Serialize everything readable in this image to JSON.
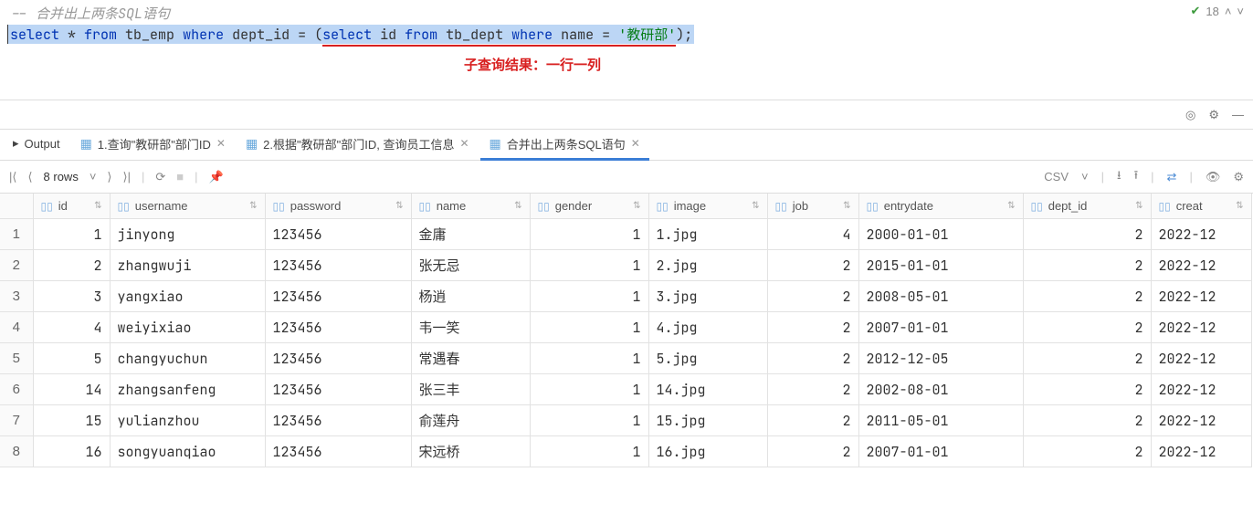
{
  "editor": {
    "comment": "-- 合并出上两条SQL语句",
    "sql_select": "select",
    "sql_star": " * ",
    "sql_from": "from",
    "tb_emp": " tb_emp ",
    "sql_where": "where",
    "dept_id_eq": " dept_id = (",
    "sql_select2": "select",
    "id_from": " id ",
    "sql_from2": "from",
    "tb_dept": " tb_dept ",
    "sql_where2": "where",
    "name_eq": " name = ",
    "lit": "'教研部'",
    "close": ");",
    "annotation": "子查询结果：一行一列"
  },
  "status": {
    "count": "18"
  },
  "tabs": {
    "output": "Output",
    "t1": "1.查询\"教研部\"部门ID",
    "t2": "2.根据\"教研部\"部门ID, 查询员工信息",
    "t3": "合并出上两条SQL语句"
  },
  "resultbar": {
    "rows": "8 rows",
    "csv": "CSV"
  },
  "columns": [
    "id",
    "username",
    "password",
    "name",
    "gender",
    "image",
    "job",
    "entrydate",
    "dept_id",
    "creat"
  ],
  "rows": [
    {
      "n": "1",
      "id": "1",
      "username": "jinyong",
      "password": "123456",
      "name": "金庸",
      "gender": "1",
      "image": "1.jpg",
      "job": "4",
      "entrydate": "2000-01-01",
      "dept_id": "2",
      "creat": "2022-12"
    },
    {
      "n": "2",
      "id": "2",
      "username": "zhangwuji",
      "password": "123456",
      "name": "张无忌",
      "gender": "1",
      "image": "2.jpg",
      "job": "2",
      "entrydate": "2015-01-01",
      "dept_id": "2",
      "creat": "2022-12"
    },
    {
      "n": "3",
      "id": "3",
      "username": "yangxiao",
      "password": "123456",
      "name": "杨逍",
      "gender": "1",
      "image": "3.jpg",
      "job": "2",
      "entrydate": "2008-05-01",
      "dept_id": "2",
      "creat": "2022-12"
    },
    {
      "n": "4",
      "id": "4",
      "username": "weiyixiao",
      "password": "123456",
      "name": "韦一笑",
      "gender": "1",
      "image": "4.jpg",
      "job": "2",
      "entrydate": "2007-01-01",
      "dept_id": "2",
      "creat": "2022-12"
    },
    {
      "n": "5",
      "id": "5",
      "username": "changyuchun",
      "password": "123456",
      "name": "常遇春",
      "gender": "1",
      "image": "5.jpg",
      "job": "2",
      "entrydate": "2012-12-05",
      "dept_id": "2",
      "creat": "2022-12"
    },
    {
      "n": "6",
      "id": "14",
      "username": "zhangsanfeng",
      "password": "123456",
      "name": "张三丰",
      "gender": "1",
      "image": "14.jpg",
      "job": "2",
      "entrydate": "2002-08-01",
      "dept_id": "2",
      "creat": "2022-12"
    },
    {
      "n": "7",
      "id": "15",
      "username": "yulianzhou",
      "password": "123456",
      "name": "俞莲舟",
      "gender": "1",
      "image": "15.jpg",
      "job": "2",
      "entrydate": "2011-05-01",
      "dept_id": "2",
      "creat": "2022-12"
    },
    {
      "n": "8",
      "id": "16",
      "username": "songyuanqiao",
      "password": "123456",
      "name": "宋远桥",
      "gender": "1",
      "image": "16.jpg",
      "job": "2",
      "entrydate": "2007-01-01",
      "dept_id": "2",
      "creat": "2022-12"
    }
  ]
}
